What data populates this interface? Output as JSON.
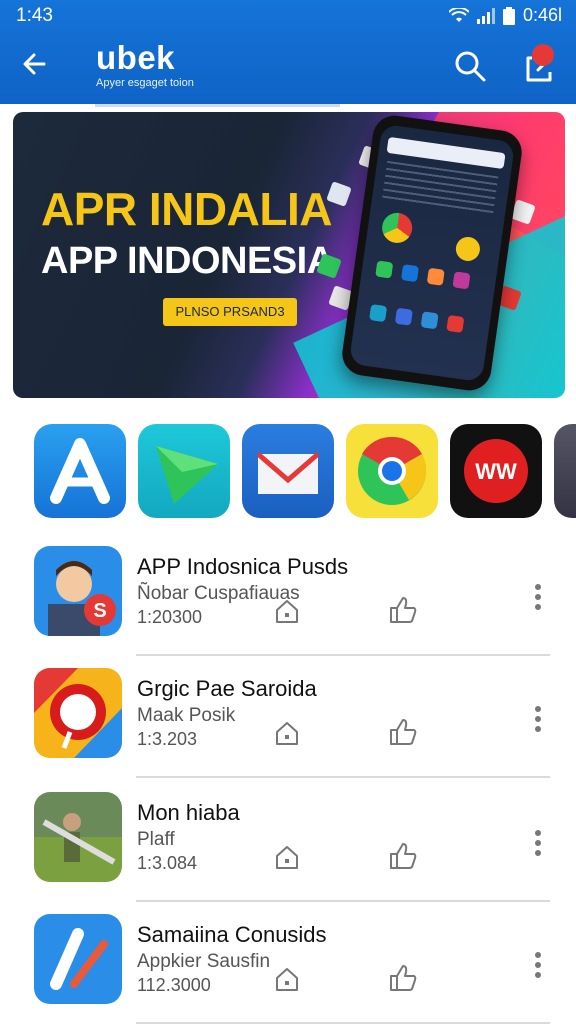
{
  "status_bar": {
    "time": "1:43",
    "battery": "0:46l"
  },
  "app_bar": {
    "title": "ubek",
    "tagline": "Apyer esgaget toion"
  },
  "banner": {
    "headline_1": "APR INDALIA",
    "headline_2": "APP INDONESIA",
    "button_label": "PLNSO PRSAND3"
  },
  "icon_row": [
    {
      "icon": "a-app-icon"
    },
    {
      "icon": "green-arrow-app-icon"
    },
    {
      "icon": "mail-app-icon"
    },
    {
      "icon": "chrome-app-icon"
    },
    {
      "icon": "ww-app-icon"
    },
    {
      "icon": "partial-app-icon"
    }
  ],
  "apps": [
    {
      "title": "APP Indosnica Pusds",
      "subtitle": "Ñobar Cuspafiauas",
      "count": "1:20300",
      "icon": "person-s-app-icon"
    },
    {
      "title": "Grgic Pae Saroida",
      "subtitle": "Maak Posik",
      "count": "1:3.203",
      "icon": "red-pin-app-icon"
    },
    {
      "title": "Mon hiaba",
      "subtitle": "Plaff",
      "count": "1:3.084",
      "icon": "game-character-app-icon"
    },
    {
      "title": "Samaiina Conusids",
      "subtitle": "Appkier Sausfin",
      "count": "112.3000",
      "icon": "blue-a-app-icon"
    }
  ],
  "colors": {
    "app_bar": "#1574d8",
    "banner_yellow": "#f5c518",
    "badge": "#e53935"
  }
}
